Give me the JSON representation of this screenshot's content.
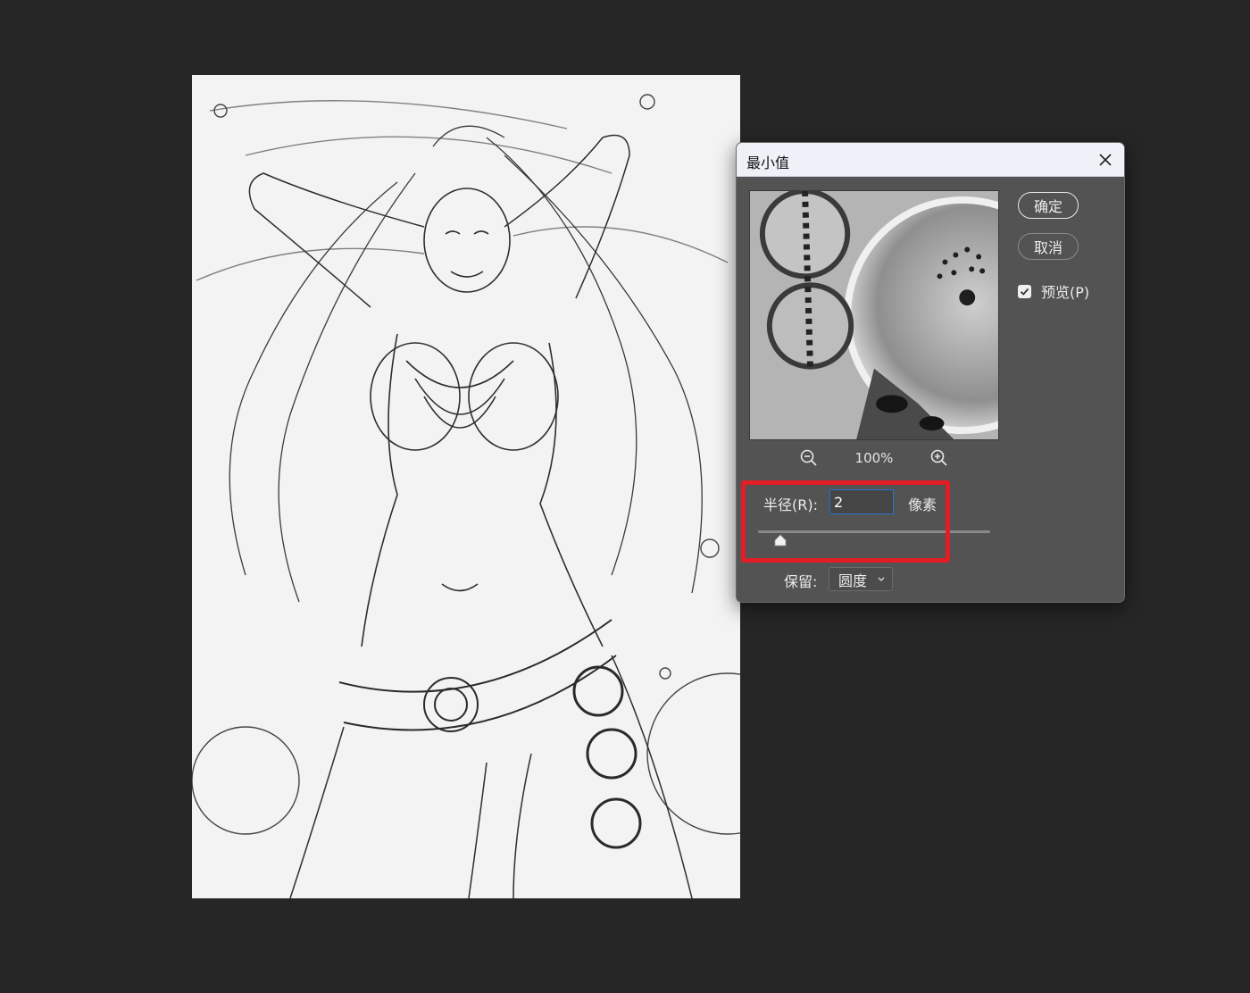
{
  "canvas": {
    "artwork": "monochrome line-art illustration"
  },
  "dialog": {
    "title": "最小值",
    "buttons": {
      "ok": "确定",
      "cancel": "取消"
    },
    "preview": {
      "label": "预览(P)",
      "checked": true
    },
    "zoom": {
      "level": "100%"
    },
    "radius": {
      "label": "半径(R):",
      "value": "2",
      "unit": "像素"
    },
    "preserve": {
      "label": "保留:",
      "value": "圆度"
    }
  },
  "colors": {
    "workspace": "#262626",
    "dialog_bg": "#535353",
    "titlebar_bg": "#eef2f8",
    "input_focus": "#2d6fd0",
    "highlight": "#e11d26"
  },
  "icons": [
    "close-icon",
    "zoom-out-icon",
    "zoom-in-icon",
    "checkmark-icon",
    "slider-thumb-icon",
    "chevron-down-icon"
  ]
}
